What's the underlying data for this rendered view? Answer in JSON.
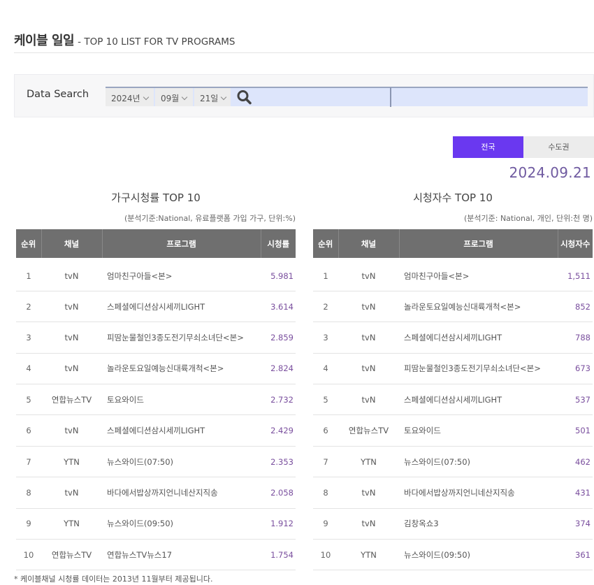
{
  "header": {
    "title_ko": "케이블 일일",
    "title_en": "- TOP 10 LIST FOR TV PROGRAMS"
  },
  "search": {
    "label": "Data Search",
    "year": "2024년",
    "month": "09월",
    "day": "21일",
    "search_icon": "search-icon"
  },
  "region_tabs": [
    {
      "label": "전국",
      "active": true
    },
    {
      "label": "수도권",
      "active": false
    }
  ],
  "date": "2024.09.21",
  "colors": {
    "accent": "#6a38f0",
    "value_text": "#7a4f9e",
    "header_bg": "#6f6f6f"
  },
  "household": {
    "title": "가구시청률 TOP 10",
    "note": "(분석기준:National, 유료플랫폼 가입 가구, 단위:%)",
    "columns": [
      "순위",
      "채널",
      "프로그램",
      "시청률"
    ],
    "rows": [
      {
        "rank": "1",
        "channel": "tvN",
        "program": "엄마친구아들<본>",
        "value": "5.981"
      },
      {
        "rank": "2",
        "channel": "tvN",
        "program": "스페셜에디션삼시세끼LIGHT",
        "value": "3.614"
      },
      {
        "rank": "3",
        "channel": "tvN",
        "program": "피땀눈물철인3종도전기무쇠소녀단<본>",
        "value": "2.859"
      },
      {
        "rank": "4",
        "channel": "tvN",
        "program": "놀라운토요일예능신대륙개척<본>",
        "value": "2.824"
      },
      {
        "rank": "5",
        "channel": "연합뉴스TV",
        "program": "토요와이드",
        "value": "2.732"
      },
      {
        "rank": "6",
        "channel": "tvN",
        "program": "스페셜에디션삼시세끼LIGHT",
        "value": "2.429"
      },
      {
        "rank": "7",
        "channel": "YTN",
        "program": "뉴스와이드(07:50)",
        "value": "2.353"
      },
      {
        "rank": "8",
        "channel": "tvN",
        "program": "바다에서밥상까지언니네산지직송",
        "value": "2.058"
      },
      {
        "rank": "9",
        "channel": "YTN",
        "program": "뉴스와이드(09:50)",
        "value": "1.912"
      },
      {
        "rank": "10",
        "channel": "연합뉴스TV",
        "program": "연합뉴스TV뉴스17",
        "value": "1.754"
      }
    ]
  },
  "viewers": {
    "title": "시청자수 TOP 10",
    "note": "(분석기준: National, 개인, 단위:천 명)",
    "columns": [
      "순위",
      "채널",
      "프로그램",
      "시청자수"
    ],
    "rows": [
      {
        "rank": "1",
        "channel": "tvN",
        "program": "엄마친구아들<본>",
        "value": "1,511"
      },
      {
        "rank": "2",
        "channel": "tvN",
        "program": "놀라운토요일예능신대륙개척<본>",
        "value": "852"
      },
      {
        "rank": "3",
        "channel": "tvN",
        "program": "스페셜에디션삼시세끼LIGHT",
        "value": "788"
      },
      {
        "rank": "4",
        "channel": "tvN",
        "program": "피땀눈물철인3종도전기무쇠소녀단<본>",
        "value": "673"
      },
      {
        "rank": "5",
        "channel": "tvN",
        "program": "스페셜에디션삼시세끼LIGHT",
        "value": "537"
      },
      {
        "rank": "6",
        "channel": "연합뉴스TV",
        "program": "토요와이드",
        "value": "501"
      },
      {
        "rank": "7",
        "channel": "YTN",
        "program": "뉴스와이드(07:50)",
        "value": "462"
      },
      {
        "rank": "8",
        "channel": "tvN",
        "program": "바다에서밥상까지언니네산지직송",
        "value": "431"
      },
      {
        "rank": "9",
        "channel": "tvN",
        "program": "김창옥쇼3",
        "value": "374"
      },
      {
        "rank": "10",
        "channel": "YTN",
        "program": "뉴스와이드(09:50)",
        "value": "361"
      }
    ]
  },
  "footnote": "* 케이블채널 시청률 데이터는 2013년 11월부터 제공됩니다."
}
